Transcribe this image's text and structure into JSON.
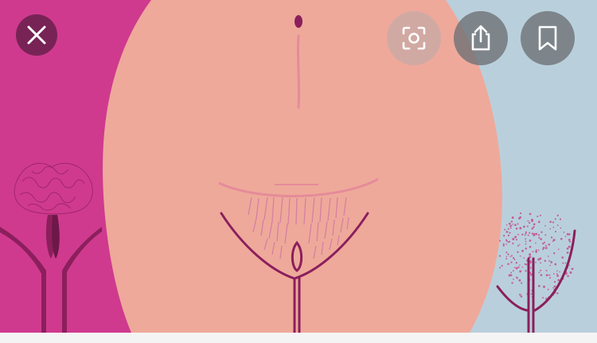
{
  "theme": {
    "left_panel_color": "#cf3a8e",
    "center_panel_color": "#eea99b",
    "right_panel_color": "#b9d0dc",
    "line_color": "#8b1f5c",
    "skin_line_color": "#e58b99"
  },
  "image": {
    "description_icon": "illustration-image"
  },
  "controls": {
    "close": {
      "icon": "close-icon"
    },
    "lens": {
      "icon": "visual-search-icon"
    },
    "share": {
      "icon": "share-icon"
    },
    "save": {
      "icon": "bookmark-icon"
    }
  }
}
